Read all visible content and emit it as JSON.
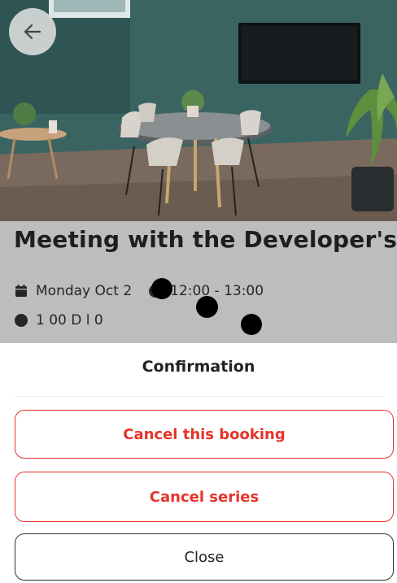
{
  "event": {
    "title": "Meeting with the Developer's ...",
    "date": "Monday Oct 2",
    "time": "12:00 - 13:00",
    "location_partial": "1 00  D    l  0"
  },
  "sheet": {
    "title": "Confirmation",
    "cancel_booking_label": "Cancel this booking",
    "cancel_series_label": "Cancel series",
    "close_label": "Close"
  },
  "icons": {
    "back": "arrow-left-icon",
    "date": "calendar-icon",
    "time": "clock-icon",
    "location": "location-icon"
  },
  "colors": {
    "danger": "#e6332a",
    "overlay": "#bdbdbd",
    "wall": "#2f5a58"
  }
}
